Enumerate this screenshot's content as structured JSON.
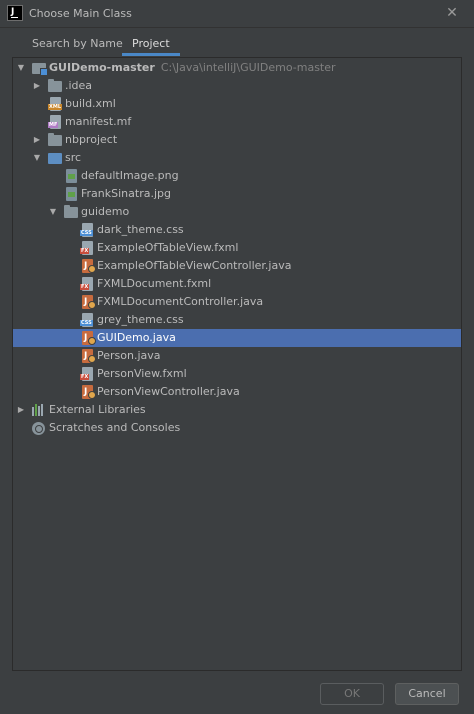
{
  "window": {
    "title": "Choose Main Class",
    "close_glyph": "✕"
  },
  "app": {
    "logo_letter": "IJ"
  },
  "tabs": [
    {
      "label": "Search by Name"
    },
    {
      "label": "Project"
    }
  ],
  "tree": {
    "root": {
      "label": "GUIDemo-master",
      "path": "C:\\Java\\intelliJ\\GUIDemo-master"
    },
    "items": [
      {
        "label": ".idea"
      },
      {
        "label": "build.xml"
      },
      {
        "label": "manifest.mf"
      },
      {
        "label": "nbproject"
      },
      {
        "label": "src"
      },
      {
        "label": "defaultImage.png"
      },
      {
        "label": "FrankSinatra.jpg"
      },
      {
        "label": "guidemo"
      },
      {
        "label": "dark_theme.css"
      },
      {
        "label": "ExampleOfTableView.fxml"
      },
      {
        "label": "ExampleOfTableViewController.java"
      },
      {
        "label": "FXMLDocument.fxml"
      },
      {
        "label": "FXMLDocumentController.java"
      },
      {
        "label": "grey_theme.css"
      },
      {
        "label": "GUIDemo.java"
      },
      {
        "label": "Person.java"
      },
      {
        "label": "PersonView.fxml"
      },
      {
        "label": "PersonViewController.java"
      },
      {
        "label": "External Libraries"
      },
      {
        "label": "Scratches and Consoles"
      }
    ],
    "selected": "GUIDemo.java"
  },
  "file_tags": {
    "xml": "XML",
    "mf": "MF",
    "css": "CSS",
    "fxml": "FX"
  },
  "buttons": {
    "ok": "OK",
    "cancel": "Cancel"
  },
  "colors": {
    "background": "#3c3f41",
    "selection": "#4b6eaf",
    "tab_underline": "#4a88c7"
  }
}
